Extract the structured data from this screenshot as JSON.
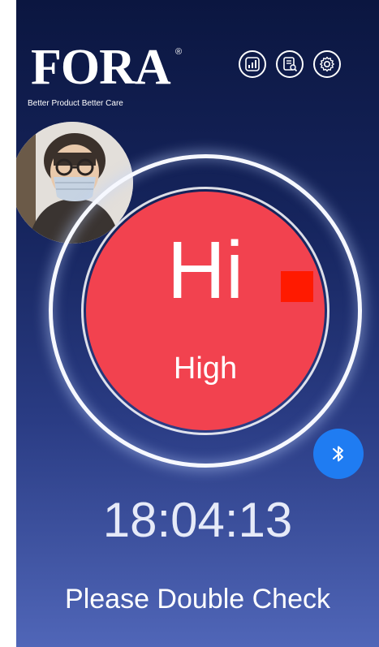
{
  "header": {
    "logo_text": "FORA",
    "logo_registered": "®",
    "tagline": "Better Product Better Care"
  },
  "toolbar": {
    "icons": [
      "chart-icon",
      "report-icon",
      "settings-icon"
    ]
  },
  "reading": {
    "value": "Hi",
    "level": "High",
    "circle_color": "#f2424f"
  },
  "status": {
    "time": "18:04:13",
    "message": "Please Double Check"
  },
  "bluetooth": {
    "icon": "bluetooth-icon",
    "color": "#1f7cf2"
  },
  "colors": {
    "background_top": "#0b1640",
    "background_bottom": "#5066b8",
    "marker": "#ff1a00"
  }
}
